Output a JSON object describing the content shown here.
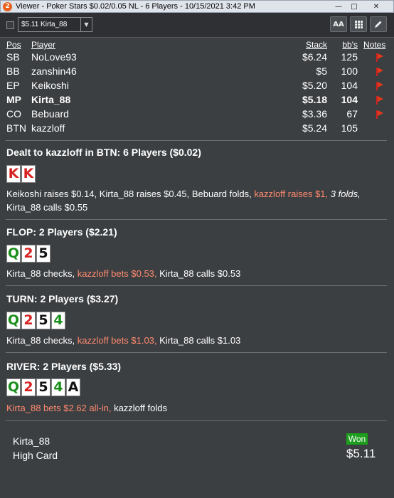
{
  "window": {
    "title": "Viewer - Poker Stars $0.02/0.05 NL - 6 Players - 10/15/2021 3:42 PM",
    "app_icon": "2",
    "minimize": "—",
    "maximize": "□",
    "close": "✕"
  },
  "toolbar": {
    "player_select": "$5.11 Kirta_88",
    "font_button": "AA"
  },
  "table": {
    "headers": {
      "pos": "Pos",
      "player": "Player",
      "stack": "Stack",
      "bbs": "bb's",
      "notes": "Notes"
    },
    "rows": [
      {
        "pos": "SB",
        "player": "NoLove93",
        "stack": "$6.24",
        "bbs": "125",
        "flag": true,
        "bold": false
      },
      {
        "pos": "BB",
        "player": "zanshin46",
        "stack": "$5",
        "bbs": "100",
        "flag": true,
        "bold": false
      },
      {
        "pos": "EP",
        "player": "Keikoshi",
        "stack": "$5.20",
        "bbs": "104",
        "flag": true,
        "bold": false
      },
      {
        "pos": "MP",
        "player": "Kirta_88",
        "stack": "$5.18",
        "bbs": "104",
        "flag": true,
        "bold": true
      },
      {
        "pos": "CO",
        "player": "Bebuard",
        "stack": "$3.36",
        "bbs": "67",
        "flag": true,
        "bold": false
      },
      {
        "pos": "BTN",
        "player": "kazzloff",
        "stack": "$5.24",
        "bbs": "105",
        "flag": false,
        "bold": false
      }
    ]
  },
  "preflop": {
    "title": "Dealt to kazzloff in BTN:",
    "sub": "6 Players ($0.02)",
    "cards": [
      {
        "rank": "K",
        "color": "red"
      },
      {
        "rank": "K",
        "color": "red"
      }
    ],
    "a1": "Keikoshi raises $0.14, Kirta_88 raises $0.45, Bebuard folds,",
    "a2": "kazzloff raises $1,",
    "a3": "3 folds,",
    "a4": "Kirta_88 calls $0.55"
  },
  "flop": {
    "title": "FLOP:",
    "sub": "2 Players ($2.21)",
    "cards": [
      {
        "rank": "Q",
        "color": "green"
      },
      {
        "rank": "2",
        "color": "red"
      },
      {
        "rank": "5",
        "color": "black"
      }
    ],
    "a1": "Kirta_88 checks,",
    "a2": "kazzloff bets $0.53,",
    "a3": "Kirta_88 calls $0.53"
  },
  "turn": {
    "title": "TURN:",
    "sub": "2 Players ($3.27)",
    "cards": [
      {
        "rank": "Q",
        "color": "green"
      },
      {
        "rank": "2",
        "color": "red"
      },
      {
        "rank": "5",
        "color": "black"
      },
      {
        "rank": "4",
        "color": "green"
      }
    ],
    "a1": "Kirta_88 checks,",
    "a2": "kazzloff bets $1.03,",
    "a3": "Kirta_88 calls $1.03"
  },
  "river": {
    "title": "RIVER:",
    "sub": "2 Players ($5.33)",
    "cards": [
      {
        "rank": "Q",
        "color": "green"
      },
      {
        "rank": "2",
        "color": "red"
      },
      {
        "rank": "5",
        "color": "black"
      },
      {
        "rank": "4",
        "color": "green"
      },
      {
        "rank": "A",
        "color": "black"
      }
    ],
    "a1": "Kirta_88 bets $2.62 all-in,",
    "a2": "kazzloff folds"
  },
  "summary": {
    "player": "Kirta_88",
    "hand": "High Card",
    "badge": "Won",
    "amount": "$5.11"
  },
  "colors": {
    "background": "#3c3f42",
    "highlight": "#ff8a6e",
    "won": "#1d9e1d",
    "flag": "#e03a1a"
  }
}
